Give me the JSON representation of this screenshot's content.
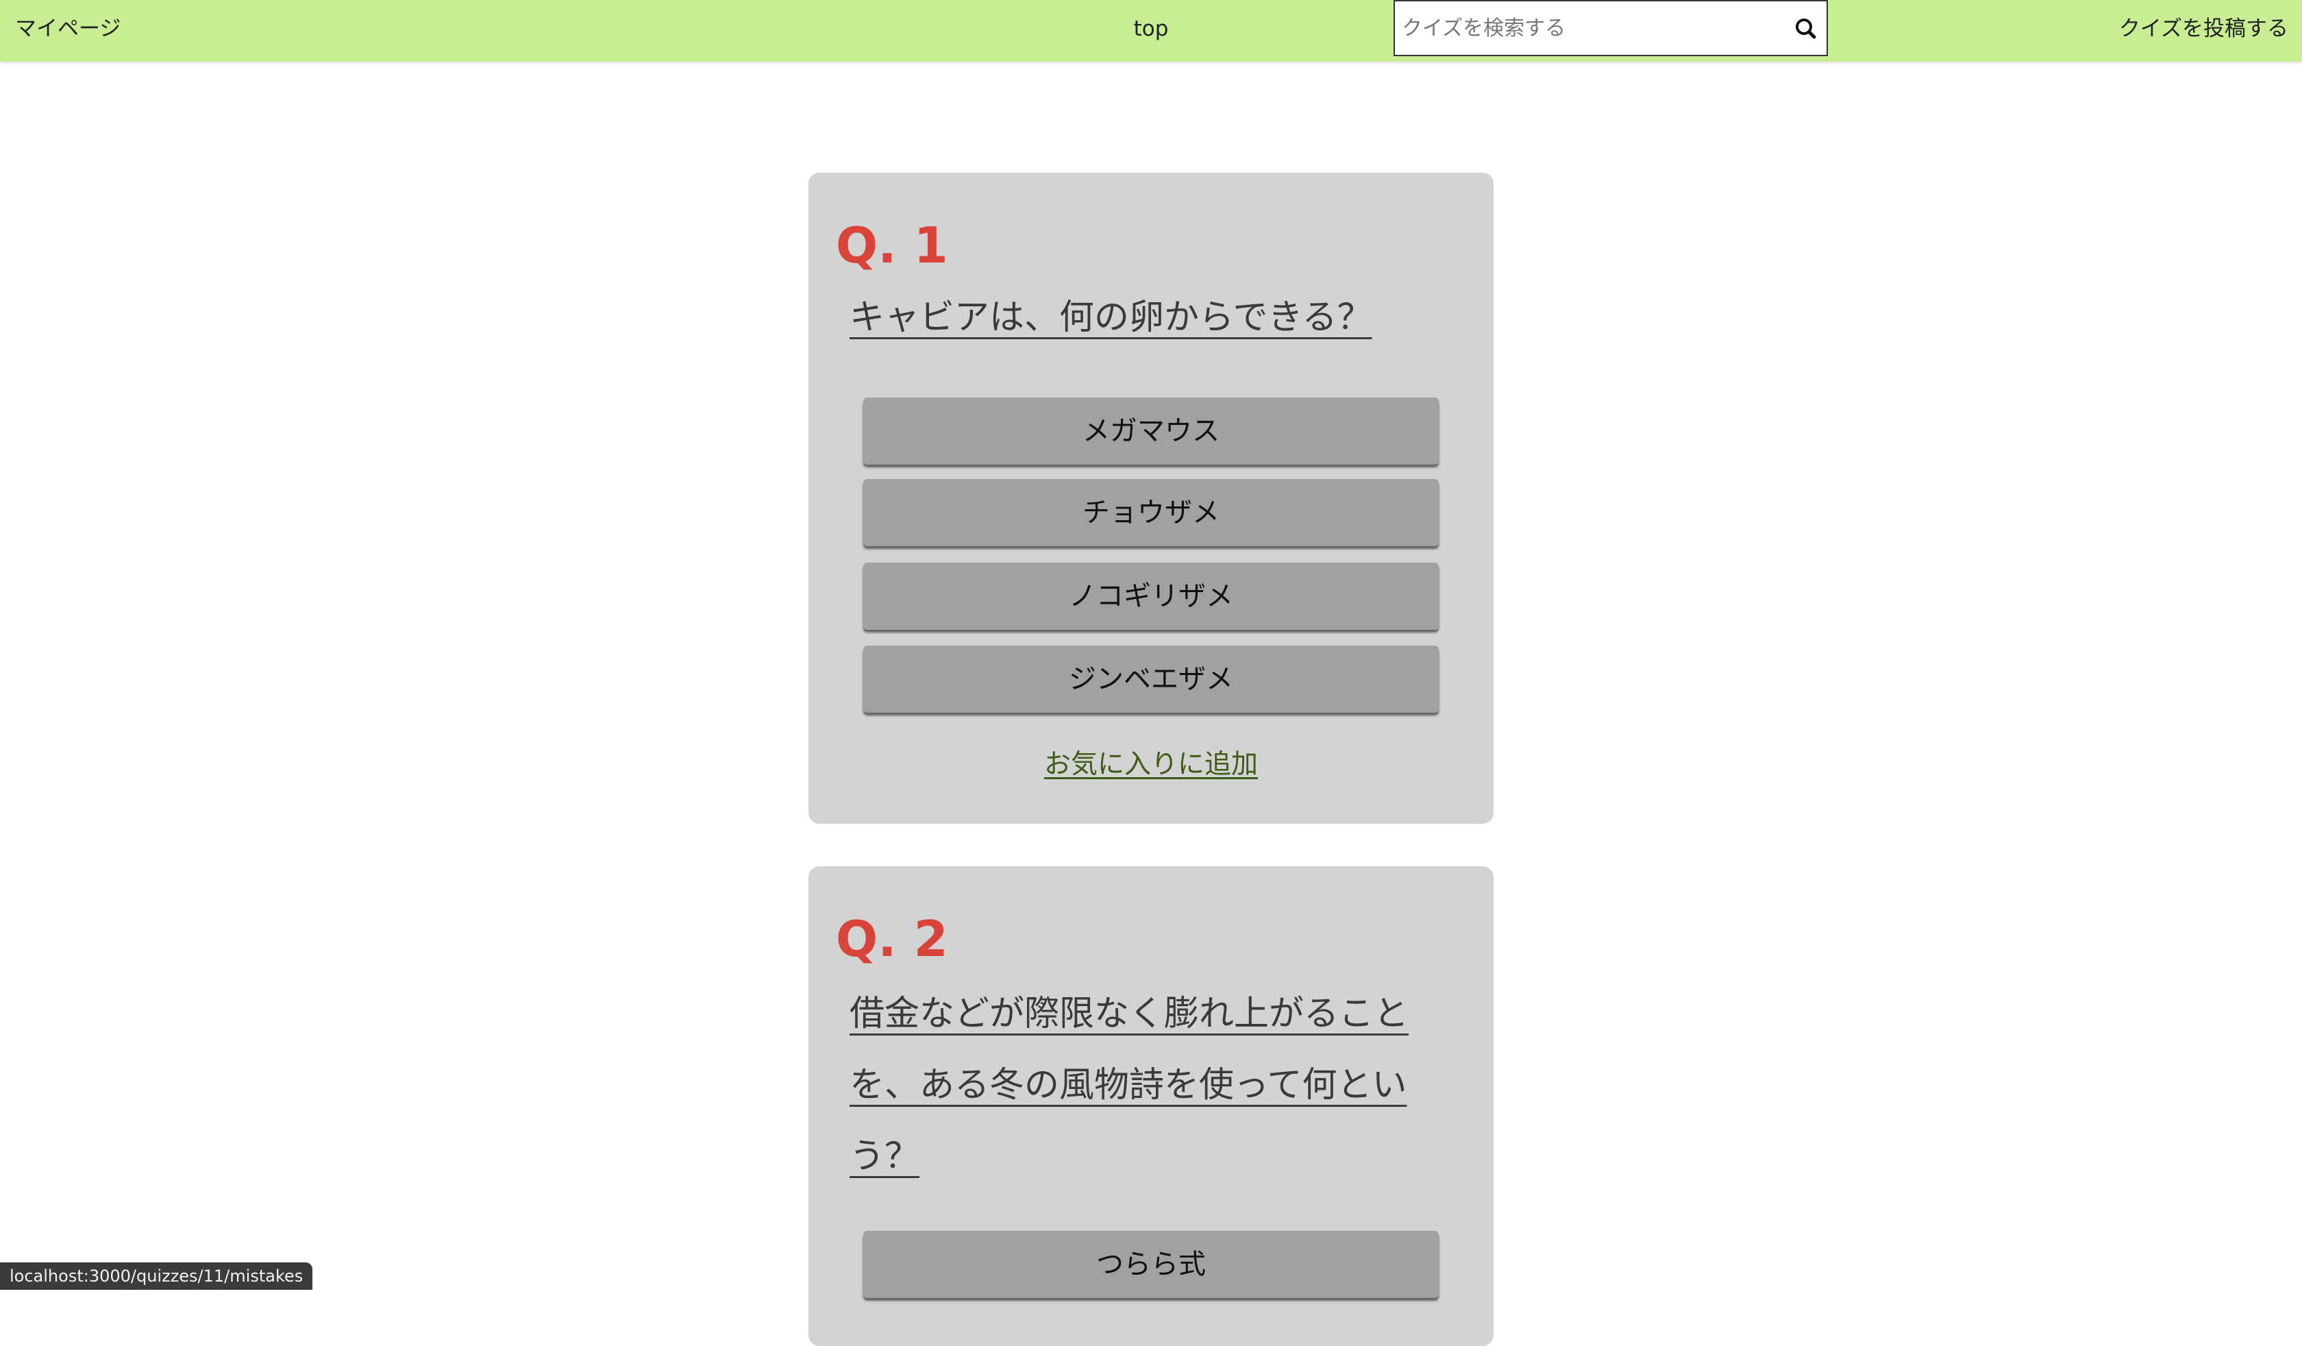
{
  "navbar": {
    "mypage_label": "マイページ",
    "top_label": "top",
    "post_label": "クイズを投稿する",
    "background": "#c8ed93"
  },
  "search": {
    "placeholder": "クイズを検索する",
    "value": "",
    "icon": "search-icon"
  },
  "quizzes": [
    {
      "number": "Q. 1",
      "question": "キャビアは、何の卵からできる？",
      "choices": [
        "メガマウス",
        "チョウザメ",
        "ノコギリザメ",
        "ジンベエザメ"
      ],
      "favorite_label": "お気に入りに追加"
    },
    {
      "number": "Q. 2",
      "question": "借金などが際限なく膨れ上がることを、ある冬の風物詩を使って何という？",
      "choices": [
        "つらら式"
      ]
    }
  ],
  "status_bar": {
    "url": "localhost:3000/quizzes/11/mistakes"
  },
  "colors": {
    "question_number": "#d9443a",
    "card_background": "#d3d3d3",
    "choice_background": "#a1a1a1",
    "favorite_link": "#3f5c16"
  }
}
